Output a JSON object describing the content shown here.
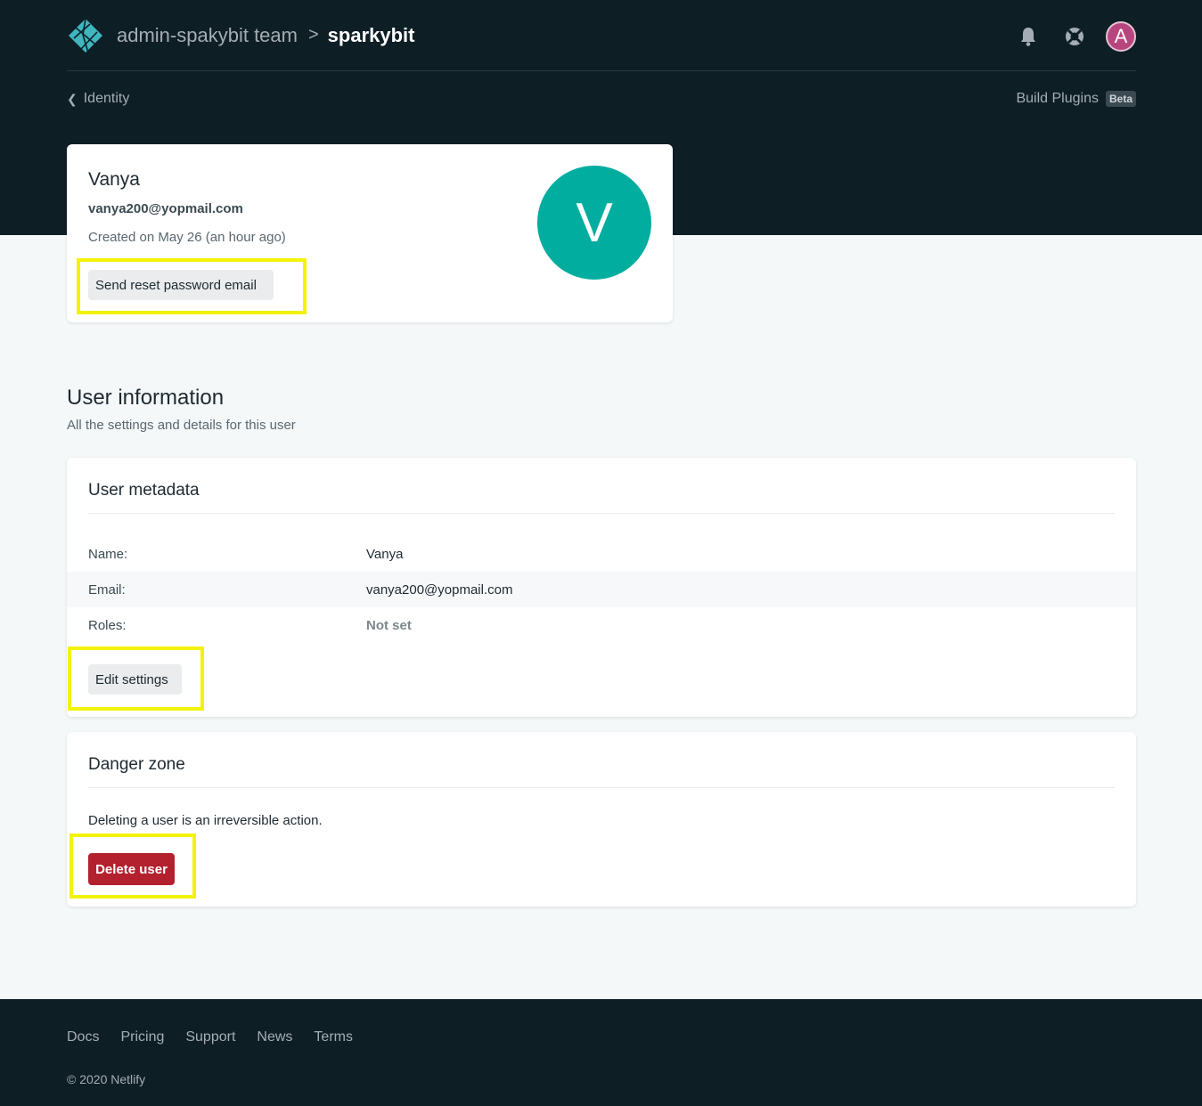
{
  "header": {
    "team": "admin-spakybit team",
    "separator": ">",
    "site": "sparkybit",
    "avatar_initial": "A",
    "icons": [
      "bell-icon",
      "lifebuoy-icon"
    ]
  },
  "subnav": {
    "back_label": "Identity",
    "plugins_label": "Build Plugins",
    "plugins_badge": "Beta"
  },
  "user": {
    "name": "Vanya",
    "email": "vanya200@yopmail.com",
    "created": "Created on May 26 (an hour ago)",
    "avatar_initial": "V",
    "reset_label": "Send reset password email"
  },
  "section": {
    "title": "User information",
    "description": "All the settings and details for this user"
  },
  "metadata": {
    "title": "User metadata",
    "rows": [
      {
        "key": "Name:",
        "value": "Vanya"
      },
      {
        "key": "Email:",
        "value": "vanya200@yopmail.com"
      },
      {
        "key": "Roles:",
        "value": "Not set"
      }
    ],
    "edit_label": "Edit settings"
  },
  "danger": {
    "title": "Danger zone",
    "text": "Deleting a user is an irreversible action.",
    "delete_label": "Delete user"
  },
  "footer": {
    "links": [
      "Docs",
      "Pricing",
      "Support",
      "News",
      "Terms"
    ],
    "copyright": "© 2020 Netlify"
  },
  "colors": {
    "header_bg": "#0e1e25",
    "avatar_teal": "#00ad9f",
    "danger_red": "#b3212e",
    "highlight_yellow": "#f3f30a"
  }
}
